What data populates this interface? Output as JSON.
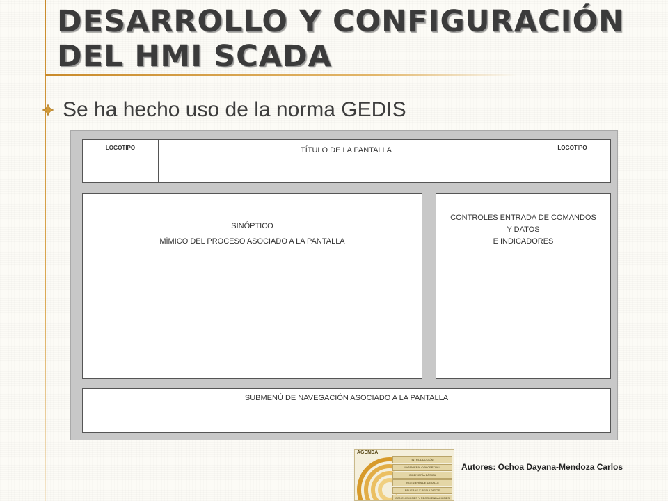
{
  "slide": {
    "title": "DESARROLLO Y CONFIGURACIÓN DEL HMI SCADA",
    "bullet": "Se ha hecho uso de la norma GEDIS",
    "accent_color": "#c98a2a",
    "bullet_icon": "diamond-bullet-icon"
  },
  "diagram": {
    "logo_left": "LOGOTIPO",
    "screen_title": "TÍTULO DE LA PANTALLA",
    "logo_right": "LOGOTIPO",
    "synoptic_title": "SINÓPTICO",
    "synoptic_desc": "MÍMICO DEL PROCESO ASOCIADO A LA PANTALLA",
    "controls_line1": "CONTROLES ENTRADA DE COMANDOS",
    "controls_line2": "Y DATOS",
    "controls_line3": "E INDICADORES",
    "submenu": "SUBMENÚ DE NAVEGACIÓN ASOCIADO A LA PANTALLA"
  },
  "agenda": {
    "title": "AGENDA",
    "items": [
      "INTRODUCCIÓN",
      "INGENIERÍA CONCEPTUAL",
      "INGENIERÍA BÁSICA",
      "INGENIERÍA DE DETALLE",
      "PRUEBAS Y RESULTADOS",
      "CONCLUSIONES Y RECOMENDACIONES"
    ]
  },
  "footer": {
    "authors": "Autores: Ochoa Dayana-Mendoza Carlos"
  }
}
